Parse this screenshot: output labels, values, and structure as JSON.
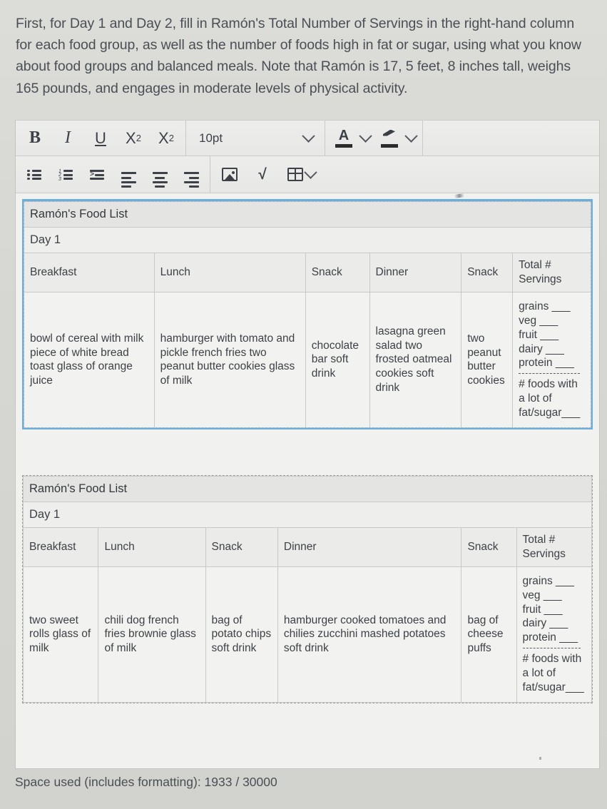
{
  "prompt": {
    "text": "First, for Day 1 and Day 2, fill in Ramón's Total Number of Servings in the right-hand column for each food group, as well as the number of foods high in fat or sugar, using what you know about food groups and balanced meals. Note that Ramón is 17, 5 feet, 8 inches tall, weighs 165 pounds, and engages in moderate levels of physical activity."
  },
  "toolbar": {
    "bold": "B",
    "italic": "I",
    "underline": "U",
    "superscript": "X",
    "superscript_exp": "2",
    "subscript": "X",
    "subscript_exp": "2",
    "font_size": "10pt",
    "text_color_glyph": "A",
    "icons": {
      "font_size_chevron": "chevron-down-icon",
      "text_color": "text-color-icon",
      "text_color_chevron": "chevron-down-icon",
      "highlight": "highlighter-icon",
      "highlight_chevron": "chevron-down-icon",
      "bullet_list": "bullet-list-icon",
      "numbered_list": "numbered-list-icon",
      "indent": "indent-icon",
      "align_left": "align-left-icon",
      "align_center": "align-center-icon",
      "align_right": "align-right-icon",
      "insert_image": "image-icon",
      "insert_equation": "square-root-icon",
      "insert_table": "table-icon",
      "table_chevron": "chevron-down-icon"
    }
  },
  "colors": {
    "selection_border": "#6aaede",
    "page_background": "#d6d6d2",
    "editor_background": "#f1f1ef",
    "toolbar_background": "#ededec",
    "text": "#3d4146"
  },
  "tables": [
    {
      "selected": true,
      "title": "Ramón's Food List",
      "day": "Day 1",
      "headers": [
        "Breakfast",
        "Lunch",
        "Snack",
        "Dinner",
        "Snack",
        "Total # Servings"
      ],
      "cells": {
        "breakfast": "bowl of cereal with milk piece of white bread toast glass of orange juice",
        "lunch": "hamburger with tomato and pickle french fries two peanut butter cookies glass of milk",
        "snack1": "chocolate bar soft drink",
        "dinner": "lasagna green salad two frosted oatmeal cookies soft drink",
        "snack2": "two peanut butter cookies"
      },
      "totals": {
        "grains": "grains ___",
        "veg": "veg ___",
        "fruit": "fruit ___",
        "dairy": "dairy ___",
        "protein": "protein ___",
        "fat_sugar": "# foods with a lot of fat/sugar___"
      }
    },
    {
      "selected": false,
      "title": "Ramón's Food List",
      "day": "Day 1",
      "headers": [
        "Breakfast",
        "Lunch",
        "Snack",
        "Dinner",
        "Snack",
        "Total # Servings"
      ],
      "cells": {
        "breakfast": "two sweet rolls glass of milk",
        "lunch": "chili dog french fries brownie glass of milk",
        "snack1": "bag of potato chips soft drink",
        "dinner": "hamburger cooked tomatoes and chilies zucchini mashed potatoes soft drink",
        "snack2": "bag of cheese puffs"
      },
      "totals": {
        "grains": "grains ___",
        "veg": "veg ___",
        "fruit": "fruit ___",
        "dairy": "dairy ___",
        "protein": "protein ___",
        "fat_sugar": "# foods with a lot of fat/sugar___"
      }
    }
  ],
  "status": {
    "space_used": "Space used (includes formatting): 1933 / 30000"
  }
}
